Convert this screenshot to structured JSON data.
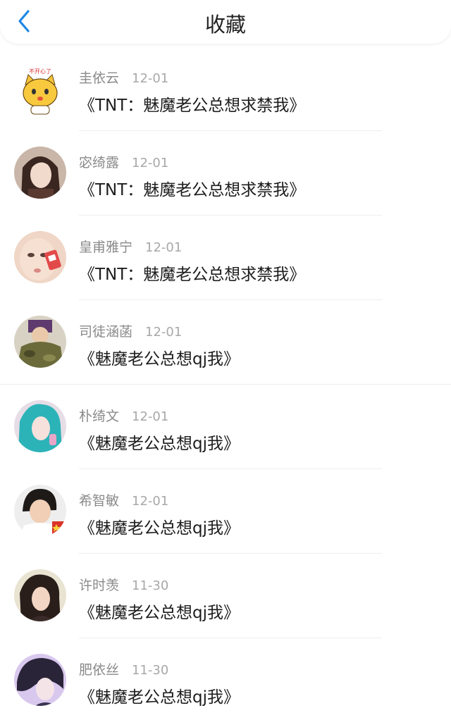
{
  "header": {
    "title": "收藏",
    "back_icon": "chevron-left-icon",
    "accent": "#1e88e5"
  },
  "items": [
    {
      "name": "圭依云",
      "date": "12-01",
      "book": "《TNT：魅魔老公总想求禁我》",
      "avatar_icon": "cartoon-cat-avatar"
    },
    {
      "name": "宓绮露",
      "date": "12-01",
      "book": "《TNT：魅魔老公总想求禁我》",
      "avatar_icon": "user-photo-avatar"
    },
    {
      "name": "皇甫雅宁",
      "date": "12-01",
      "book": "《TNT：魅魔老公总想求禁我》",
      "avatar_icon": "user-photo-avatar"
    },
    {
      "name": "司徒涵菡",
      "date": "12-01",
      "book": "《魅魔老公总想qj我》",
      "avatar_icon": "user-photo-avatar"
    },
    {
      "name": "朴绮文",
      "date": "12-01",
      "book": "《魅魔老公总想qj我》",
      "avatar_icon": "user-photo-avatar"
    },
    {
      "name": "希智敏",
      "date": "12-01",
      "book": "《魅魔老公总想qj我》",
      "avatar_icon": "user-photo-avatar"
    },
    {
      "name": "许时羡",
      "date": "11-30",
      "book": "《魅魔老公总想qj我》",
      "avatar_icon": "user-photo-avatar"
    },
    {
      "name": "肥依丝",
      "date": "11-30",
      "book": "《魅魔老公总想qj我》",
      "avatar_icon": "user-photo-avatar"
    }
  ]
}
